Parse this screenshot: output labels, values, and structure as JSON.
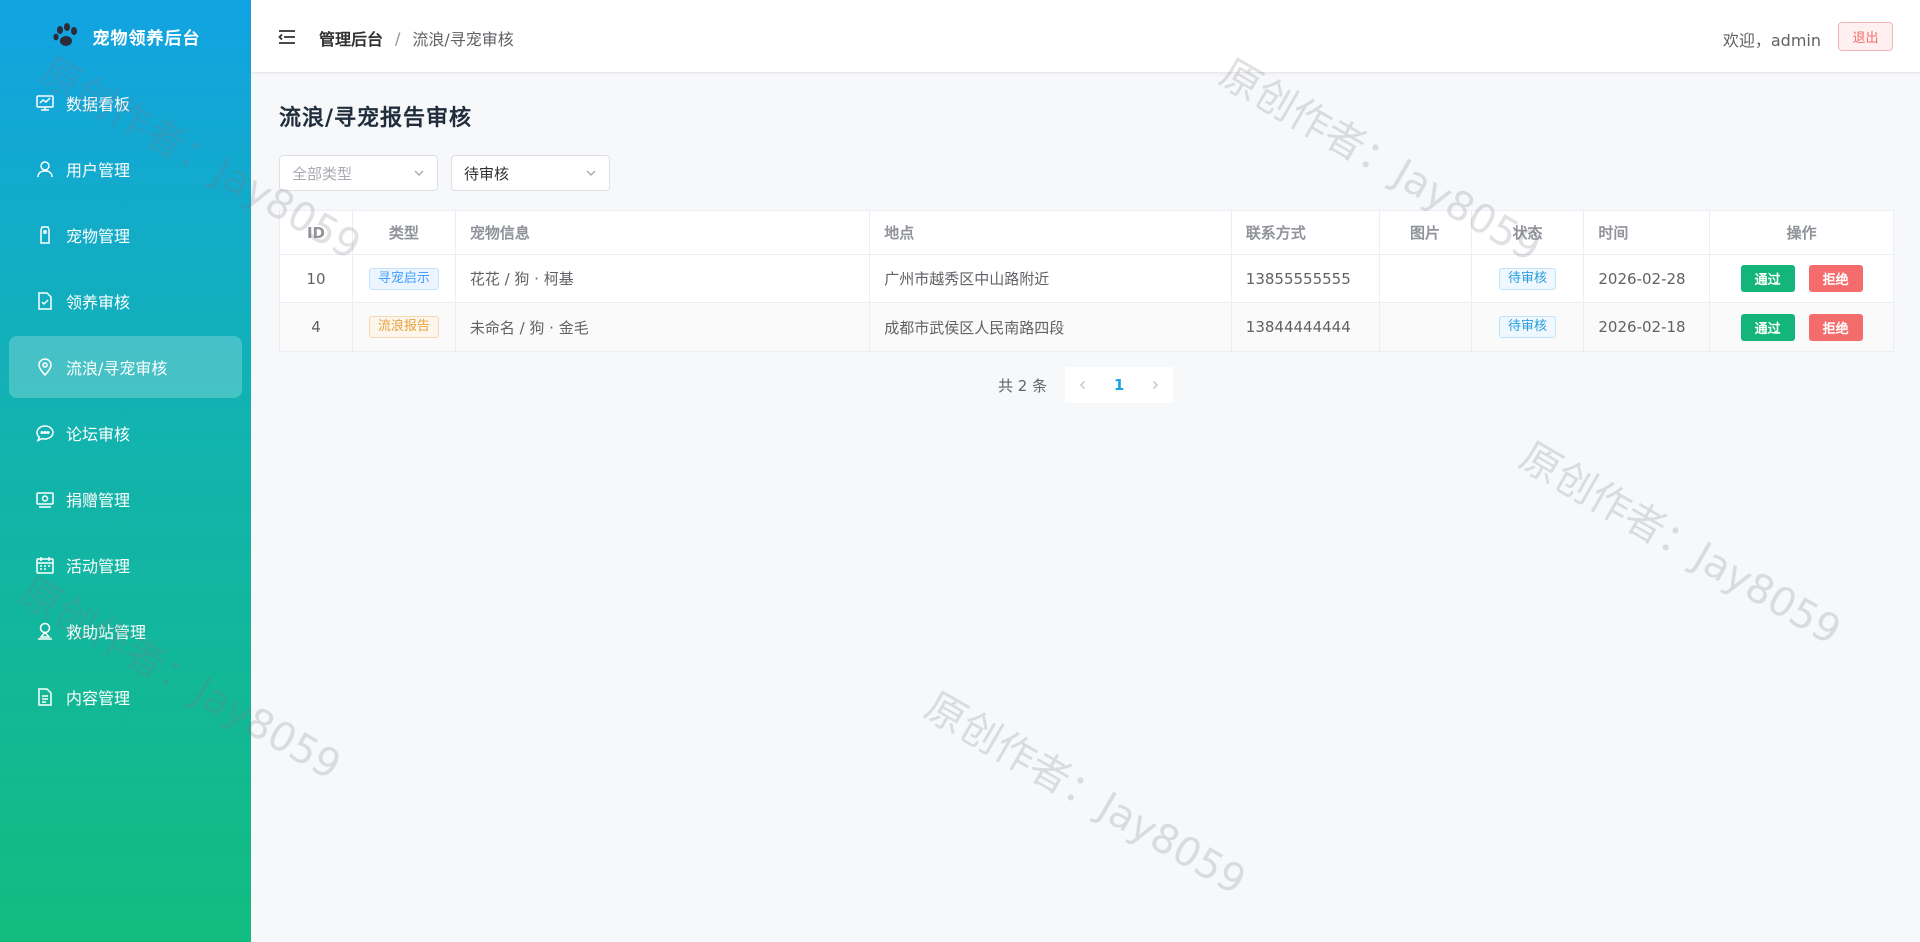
{
  "app": {
    "title": "宠物领养后台"
  },
  "sidebar": {
    "items": [
      {
        "label": "数据看板",
        "icon": "dashboard-icon"
      },
      {
        "label": "用户管理",
        "icon": "user-icon"
      },
      {
        "label": "宠物管理",
        "icon": "tag-icon"
      },
      {
        "label": "领养审核",
        "icon": "doc-check-icon"
      },
      {
        "label": "流浪/寻宠审核",
        "icon": "location-icon"
      },
      {
        "label": "论坛审核",
        "icon": "chat-icon"
      },
      {
        "label": "捐赠管理",
        "icon": "money-icon"
      },
      {
        "label": "活动管理",
        "icon": "calendar-icon"
      },
      {
        "label": "救助站管理",
        "icon": "map-pin-icon"
      },
      {
        "label": "内容管理",
        "icon": "document-icon"
      }
    ],
    "active_index": 4
  },
  "header": {
    "breadcrumb_home": "管理后台",
    "breadcrumb_sep": "/",
    "breadcrumb_current": "流浪/寻宠审核",
    "welcome": "欢迎，admin",
    "logout": "退出"
  },
  "page": {
    "title": "流浪/寻宠报告审核"
  },
  "filters": {
    "type": {
      "placeholder": "全部类型"
    },
    "status": {
      "value": "待审核"
    }
  },
  "table": {
    "columns": [
      "ID",
      "类型",
      "宠物信息",
      "地点",
      "联系方式",
      "图片",
      "状态",
      "时间",
      "操作"
    ],
    "rows": [
      {
        "id": "10",
        "type": "寻宠启示",
        "pet": "花花 / 狗 · 柯基",
        "location": "广州市越秀区中山路附近",
        "contact": "13855555555",
        "image": "",
        "status": "待审核",
        "time": "2026-02-28",
        "pass": "通过",
        "reject": "拒绝"
      },
      {
        "id": "4",
        "type": "流浪报告",
        "pet": "未命名 / 狗 · 金毛",
        "location": "成都市武侯区人民南路四段",
        "contact": "13844444444",
        "image": "",
        "status": "待审核",
        "time": "2026-02-18",
        "pass": "通过",
        "reject": "拒绝"
      }
    ]
  },
  "pagination": {
    "total": "共 2 条",
    "current": "1"
  },
  "watermark": "原创作者：Jay8059",
  "colors": {
    "primary": "#12a3e3",
    "success": "#13b57a",
    "danger": "#f56c6c"
  }
}
